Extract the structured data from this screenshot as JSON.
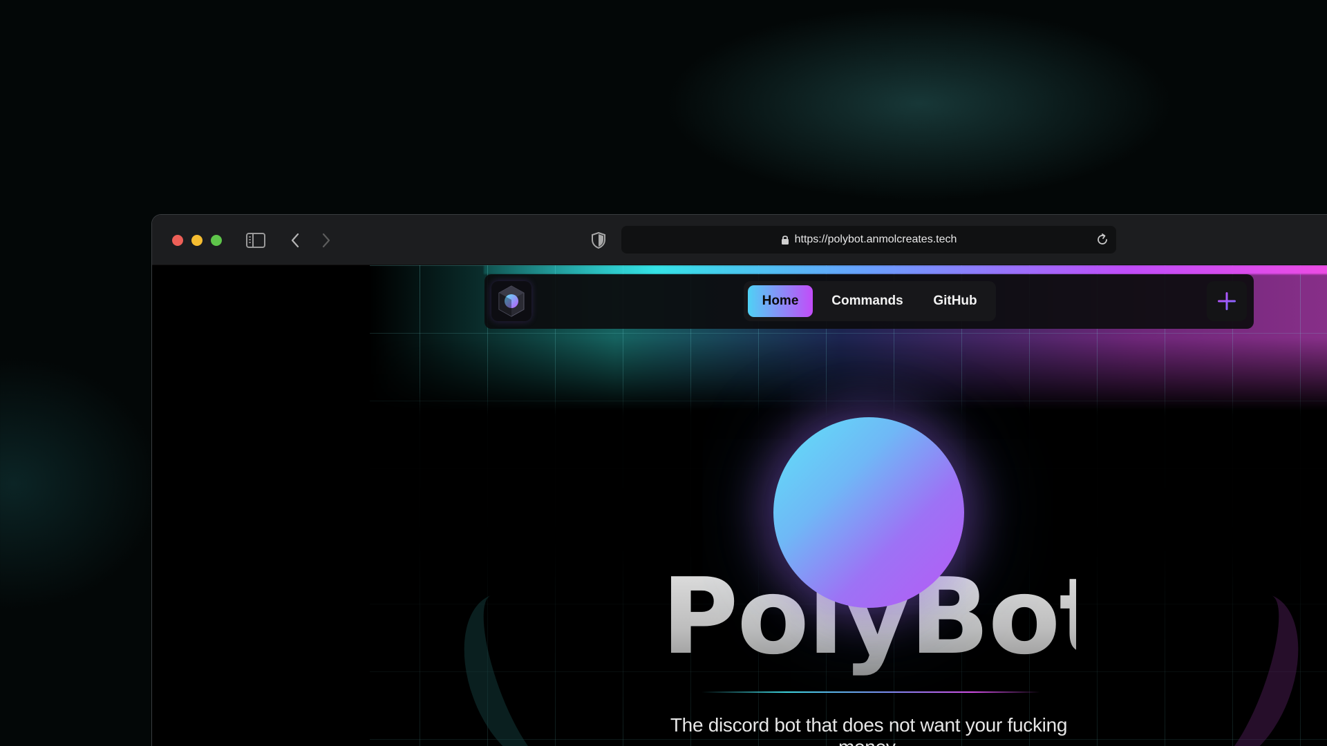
{
  "browser": {
    "url": "https://polybot.anmolcreates.tech",
    "icons": [
      "sidebar-icon",
      "back-icon",
      "forward-icon",
      "shield-icon",
      "lock-icon",
      "reload-icon"
    ]
  },
  "navbar": {
    "items": [
      {
        "label": "Home",
        "active": true
      },
      {
        "label": "Commands",
        "active": false
      },
      {
        "label": "GitHub",
        "active": false
      }
    ],
    "plus_icon": "plus-icon"
  },
  "hero": {
    "title": "PolyBot",
    "tagline": "The discord bot that does not want your fucking money."
  },
  "colors": {
    "accent_cyan": "#4fd1f5",
    "accent_purple": "#c24cf8",
    "background": "#000000"
  }
}
